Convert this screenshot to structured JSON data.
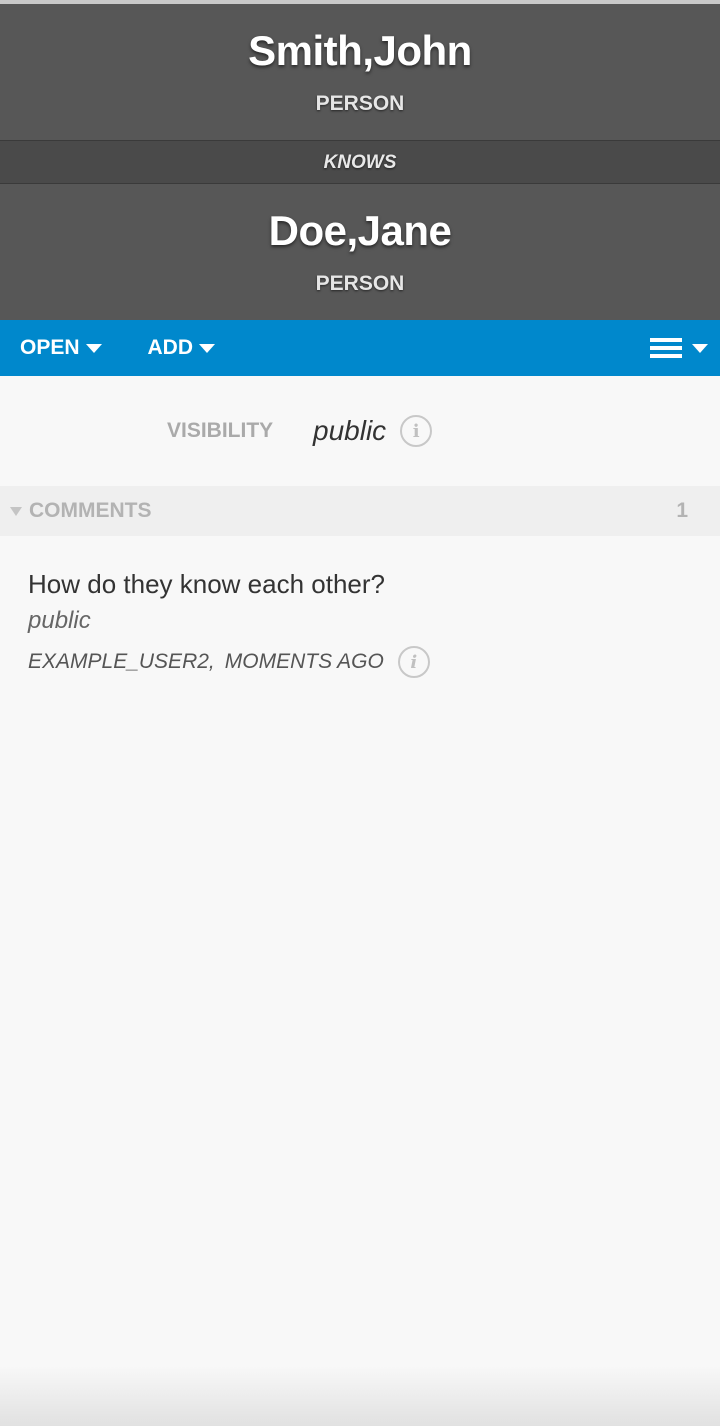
{
  "source_entity": {
    "name": "Smith,John",
    "type": "PERSON"
  },
  "relationship": {
    "label": "KNOWS"
  },
  "target_entity": {
    "name": "Doe,Jane",
    "type": "PERSON"
  },
  "toolbar": {
    "open_label": "OPEN",
    "add_label": "ADD",
    "menu_icon": "hamburger-icon",
    "accent_color": "#0088cc"
  },
  "visibility": {
    "label": "VISIBILITY",
    "value": "public"
  },
  "comments": {
    "header": "COMMENTS",
    "count": "1",
    "items": [
      {
        "text": "How do they know each other?",
        "visibility": "public",
        "author": "EXAMPLE_USER2,",
        "time": "MOMENTS AGO"
      }
    ]
  }
}
